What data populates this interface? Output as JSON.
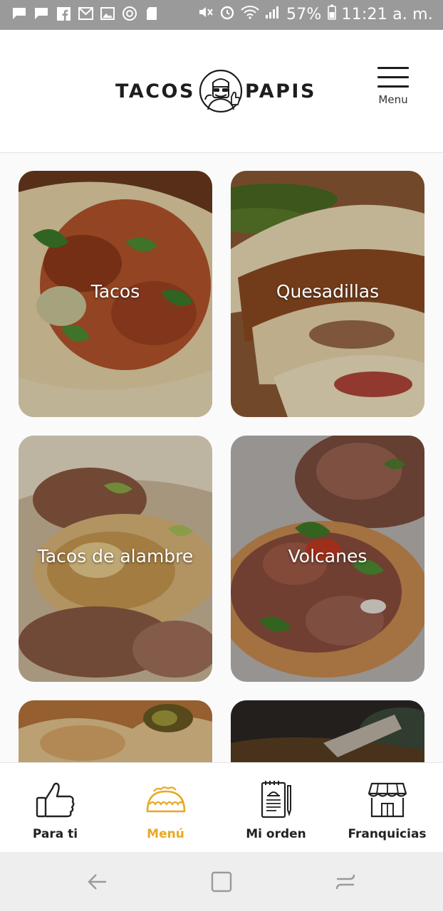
{
  "status_bar": {
    "left_icons": [
      "message-icon",
      "message-icon",
      "facebook-icon",
      "gmail-icon",
      "gallery-icon",
      "sync-icon",
      "sd-card-icon"
    ],
    "right_icons": [
      "mute-icon",
      "alarm-icon",
      "wifi-icon",
      "signal-icon",
      "battery-icon"
    ],
    "battery": "57%",
    "time": "11:21 a. m."
  },
  "header": {
    "logo_left": "TACOS",
    "logo_right": "PAPIS",
    "menu_label": "Menu"
  },
  "menu_items": [
    {
      "label": "Tacos",
      "image": "tacos-photo"
    },
    {
      "label": "Quesadillas",
      "image": "quesadillas-photo"
    },
    {
      "label": "Tacos de alambre",
      "image": "tacos-de-alambre-photo"
    },
    {
      "label": "Volcanes",
      "image": "volcanes-photo"
    },
    {
      "label": "",
      "image": "gringas-photo"
    },
    {
      "label": "",
      "image": "drink-photo"
    }
  ],
  "bottom_nav": [
    {
      "label": "Para ti",
      "icon": "thumbs-up-icon",
      "active": false
    },
    {
      "label": "Menú",
      "icon": "taco-icon",
      "active": true
    },
    {
      "label": "Mi orden",
      "icon": "order-notebook-icon",
      "active": false
    },
    {
      "label": "Franquicias",
      "icon": "store-icon",
      "active": false
    }
  ],
  "colors": {
    "accent": "#e8a823",
    "text_dark": "#222222",
    "status_bar": "#9a9a9a"
  }
}
